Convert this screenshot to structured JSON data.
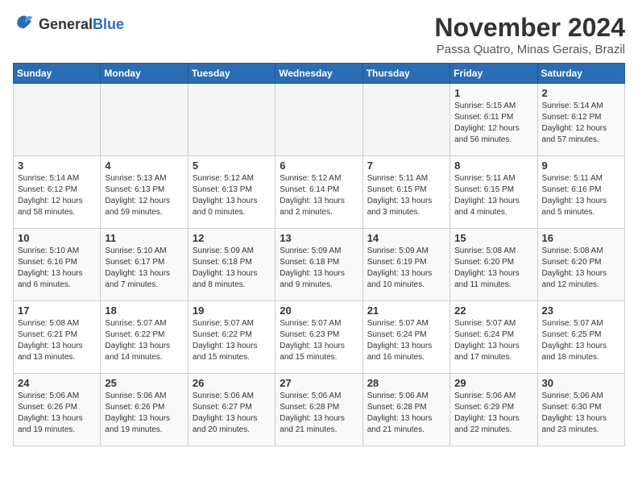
{
  "header": {
    "logo_general": "General",
    "logo_blue": "Blue",
    "month_title": "November 2024",
    "location": "Passa Quatro, Minas Gerais, Brazil"
  },
  "days_of_week": [
    "Sunday",
    "Monday",
    "Tuesday",
    "Wednesday",
    "Thursday",
    "Friday",
    "Saturday"
  ],
  "weeks": [
    [
      {
        "day": "",
        "info": ""
      },
      {
        "day": "",
        "info": ""
      },
      {
        "day": "",
        "info": ""
      },
      {
        "day": "",
        "info": ""
      },
      {
        "day": "",
        "info": ""
      },
      {
        "day": "1",
        "info": "Sunrise: 5:15 AM\nSunset: 6:11 PM\nDaylight: 12 hours and 56 minutes."
      },
      {
        "day": "2",
        "info": "Sunrise: 5:14 AM\nSunset: 6:12 PM\nDaylight: 12 hours and 57 minutes."
      }
    ],
    [
      {
        "day": "3",
        "info": "Sunrise: 5:14 AM\nSunset: 6:12 PM\nDaylight: 12 hours and 58 minutes."
      },
      {
        "day": "4",
        "info": "Sunrise: 5:13 AM\nSunset: 6:13 PM\nDaylight: 12 hours and 59 minutes."
      },
      {
        "day": "5",
        "info": "Sunrise: 5:12 AM\nSunset: 6:13 PM\nDaylight: 13 hours and 0 minutes."
      },
      {
        "day": "6",
        "info": "Sunrise: 5:12 AM\nSunset: 6:14 PM\nDaylight: 13 hours and 2 minutes."
      },
      {
        "day": "7",
        "info": "Sunrise: 5:11 AM\nSunset: 6:15 PM\nDaylight: 13 hours and 3 minutes."
      },
      {
        "day": "8",
        "info": "Sunrise: 5:11 AM\nSunset: 6:15 PM\nDaylight: 13 hours and 4 minutes."
      },
      {
        "day": "9",
        "info": "Sunrise: 5:11 AM\nSunset: 6:16 PM\nDaylight: 13 hours and 5 minutes."
      }
    ],
    [
      {
        "day": "10",
        "info": "Sunrise: 5:10 AM\nSunset: 6:16 PM\nDaylight: 13 hours and 6 minutes."
      },
      {
        "day": "11",
        "info": "Sunrise: 5:10 AM\nSunset: 6:17 PM\nDaylight: 13 hours and 7 minutes."
      },
      {
        "day": "12",
        "info": "Sunrise: 5:09 AM\nSunset: 6:18 PM\nDaylight: 13 hours and 8 minutes."
      },
      {
        "day": "13",
        "info": "Sunrise: 5:09 AM\nSunset: 6:18 PM\nDaylight: 13 hours and 9 minutes."
      },
      {
        "day": "14",
        "info": "Sunrise: 5:09 AM\nSunset: 6:19 PM\nDaylight: 13 hours and 10 minutes."
      },
      {
        "day": "15",
        "info": "Sunrise: 5:08 AM\nSunset: 6:20 PM\nDaylight: 13 hours and 11 minutes."
      },
      {
        "day": "16",
        "info": "Sunrise: 5:08 AM\nSunset: 6:20 PM\nDaylight: 13 hours and 12 minutes."
      }
    ],
    [
      {
        "day": "17",
        "info": "Sunrise: 5:08 AM\nSunset: 6:21 PM\nDaylight: 13 hours and 13 minutes."
      },
      {
        "day": "18",
        "info": "Sunrise: 5:07 AM\nSunset: 6:22 PM\nDaylight: 13 hours and 14 minutes."
      },
      {
        "day": "19",
        "info": "Sunrise: 5:07 AM\nSunset: 6:22 PM\nDaylight: 13 hours and 15 minutes."
      },
      {
        "day": "20",
        "info": "Sunrise: 5:07 AM\nSunset: 6:23 PM\nDaylight: 13 hours and 15 minutes."
      },
      {
        "day": "21",
        "info": "Sunrise: 5:07 AM\nSunset: 6:24 PM\nDaylight: 13 hours and 16 minutes."
      },
      {
        "day": "22",
        "info": "Sunrise: 5:07 AM\nSunset: 6:24 PM\nDaylight: 13 hours and 17 minutes."
      },
      {
        "day": "23",
        "info": "Sunrise: 5:07 AM\nSunset: 6:25 PM\nDaylight: 13 hours and 18 minutes."
      }
    ],
    [
      {
        "day": "24",
        "info": "Sunrise: 5:06 AM\nSunset: 6:26 PM\nDaylight: 13 hours and 19 minutes."
      },
      {
        "day": "25",
        "info": "Sunrise: 5:06 AM\nSunset: 6:26 PM\nDaylight: 13 hours and 19 minutes."
      },
      {
        "day": "26",
        "info": "Sunrise: 5:06 AM\nSunset: 6:27 PM\nDaylight: 13 hours and 20 minutes."
      },
      {
        "day": "27",
        "info": "Sunrise: 5:06 AM\nSunset: 6:28 PM\nDaylight: 13 hours and 21 minutes."
      },
      {
        "day": "28",
        "info": "Sunrise: 5:06 AM\nSunset: 6:28 PM\nDaylight: 13 hours and 21 minutes."
      },
      {
        "day": "29",
        "info": "Sunrise: 5:06 AM\nSunset: 6:29 PM\nDaylight: 13 hours and 22 minutes."
      },
      {
        "day": "30",
        "info": "Sunrise: 5:06 AM\nSunset: 6:30 PM\nDaylight: 13 hours and 23 minutes."
      }
    ]
  ]
}
